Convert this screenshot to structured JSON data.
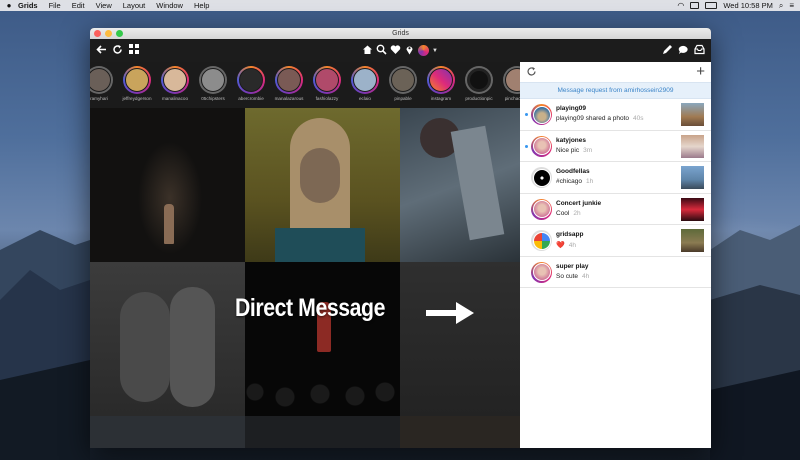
{
  "menubar": {
    "app_name": "Grids",
    "items": [
      "File",
      "Edit",
      "View",
      "Layout",
      "Window",
      "Help"
    ],
    "clock": "Wed 10:58 PM"
  },
  "window": {
    "title": "Grids"
  },
  "toolbar": {
    "left_icons": [
      "back-arrow-icon",
      "refresh-icon",
      "grid-icon"
    ],
    "center_icons": [
      "home-icon",
      "search-icon",
      "heart-icon",
      "location-pin-icon",
      "profile-icon"
    ],
    "right_icons": [
      "compose-icon",
      "direct-icon",
      "inbox-icon"
    ]
  },
  "stories": [
    {
      "name": "ramyhari"
    },
    {
      "name": "jeffreydgerson"
    },
    {
      "name": "manalinacoo"
    },
    {
      "name": "05chipsters"
    },
    {
      "name": "abercrombie"
    },
    {
      "name": "manalazarous"
    },
    {
      "name": "fashiolazzy"
    },
    {
      "name": "eclaio"
    },
    {
      "name": "pinpable"
    },
    {
      "name": "instagram"
    },
    {
      "name": "productionpic"
    },
    {
      "name": "pinchacoroll"
    }
  ],
  "overlay": {
    "title": "Direct Message"
  },
  "direct": {
    "request_text": "Message request from amirhossein2909",
    "threads": [
      {
        "user": "playing09",
        "message": "playing09 shared a photo",
        "time": "40s",
        "unread": true
      },
      {
        "user": "katyjones",
        "message": "Nice pic",
        "time": "3m",
        "unread": true
      },
      {
        "user": "Goodfellas",
        "message": "#chicago",
        "time": "1h",
        "unread": false
      },
      {
        "user": "Concert junkie",
        "message": "Cool",
        "time": "2h",
        "unread": false
      },
      {
        "user": "gridsapp",
        "message": "❤️",
        "time": "4h",
        "unread": false
      },
      {
        "user": "super play",
        "message": "So cute",
        "time": "4h",
        "unread": false
      }
    ]
  }
}
